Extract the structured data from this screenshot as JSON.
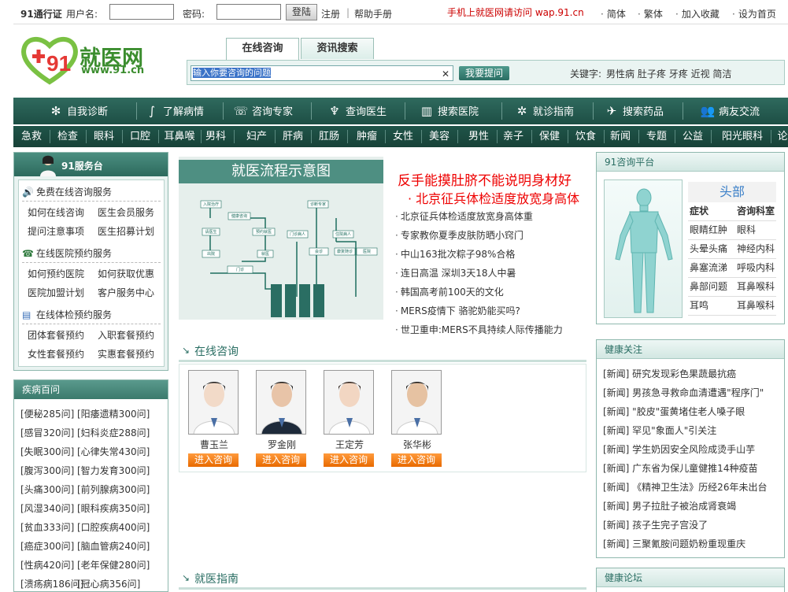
{
  "topbar": {
    "brand": "91通行证",
    "username_label": "用户名:",
    "password_label": "密码:",
    "login_button": "登陆",
    "register": "注册",
    "help": "帮助手册",
    "mobile_notice": "手机上就医网请访问  wap.91.cn",
    "links": [
      "简体",
      "繁体",
      "加入收藏",
      "设为首页"
    ]
  },
  "logo": {
    "name": "就医网",
    "url": "www.91.cn",
    "mark": "91"
  },
  "search": {
    "tabs": [
      "在线咨询",
      "资讯搜索"
    ],
    "input_value": "输入你要咨询的问题",
    "ask_button": "我要提问",
    "keywords_label": "关键字:",
    "keywords": [
      "男性病",
      "肚子疼",
      "牙疼",
      "近视",
      "简洁"
    ]
  },
  "main_nav": [
    {
      "label": "自我诊断",
      "icon": "flower-icon"
    },
    {
      "label": "了解病情",
      "icon": "stethoscope-icon"
    },
    {
      "label": "咨询专家",
      "icon": "phone-user-icon"
    },
    {
      "label": "查询医生",
      "icon": "doctor-icon"
    },
    {
      "label": "搜索医院",
      "icon": "hospital-icon"
    },
    {
      "label": "就诊指南",
      "icon": "compass-icon"
    },
    {
      "label": "搜索药品",
      "icon": "plane-icon"
    },
    {
      "label": "病友交流",
      "icon": "people-icon"
    }
  ],
  "sub_nav": [
    "急救",
    "检查",
    "眼科",
    "口腔",
    "耳鼻喉",
    "男科",
    "妇产",
    "肝病",
    "肛肠",
    "肿瘤",
    "女性",
    "美容",
    "男性",
    "亲子",
    "保健",
    "饮食",
    "新闻",
    "专题",
    "公益",
    "阳光眼科",
    "论"
  ],
  "service": {
    "title": "91服务台",
    "sections": [
      {
        "title": "免费在线咨询服务",
        "icon": "speaker-icon",
        "links": [
          "如何在线咨询",
          "医生会员服务",
          "提问注意事项",
          "医生招募计划"
        ]
      },
      {
        "title": "在线医院预约服务",
        "icon": "telephone-icon",
        "links": [
          "如何预约医院",
          "如何获取优惠",
          "医院加盟计划",
          "客户服务中心"
        ]
      },
      {
        "title": "在线体检预约服务",
        "icon": "clipboard-icon",
        "links": [
          "团体套餐预约",
          "入职套餐预约",
          "女性套餐预约",
          "实惠套餐预约"
        ]
      }
    ]
  },
  "diseases": {
    "title": "疾病百问",
    "rows": [
      [
        "[便秘285问]",
        "[阳痿遗精300问]"
      ],
      [
        "[感冒320问]",
        "[妇科炎症288问]"
      ],
      [
        "[失眠300问]",
        "[心律失常430问]"
      ],
      [
        "[腹泻300问]",
        "[智力发育300问]"
      ],
      [
        "[头痛300问]",
        "[前列腺病300问]"
      ],
      [
        "[风湿340问]",
        "[眼科疾病350问]"
      ],
      [
        "[贫血333问]",
        "[口腔疾病400问]"
      ],
      [
        "[癌症300问]",
        "[脑血管病240问]"
      ],
      [
        "[性病420问]",
        "[老年保健280问]"
      ],
      [
        "[溃疡病186问]",
        "[冠心病356问]"
      ]
    ]
  },
  "flow": {
    "title": "就医流程示意图",
    "nodes": [
      "入院治疗",
      "健康咨询",
      "预约就医",
      "请医生",
      "就医",
      "门诊",
      "出院",
      "诊断专家",
      "门诊病人",
      "住院病人",
      "会诊",
      "康复随诊",
      "医院"
    ]
  },
  "headlines": {
    "main": "反手能摸肚脐不能说明身材好",
    "sub": "· 北京征兵体检适度放宽身高体",
    "items": [
      "北京征兵体检适度放宽身高体重",
      "专家教你夏季皮肤防晒小窍门",
      "中山163批次粽子98%合格",
      "连日高温 深圳3天18人中暑",
      "韩国高考前100天的文化",
      "MERS疫情下 骆驼奶能买吗?",
      "世卫重申:MERS不具持续人际传播能力"
    ]
  },
  "online_consult": {
    "title": "在线咨询",
    "doctors": [
      {
        "name": "曹玉兰",
        "button": "进入咨询"
      },
      {
        "name": "罗金刚",
        "button": "进入咨询"
      },
      {
        "name": "王定芳",
        "button": "进入咨询"
      },
      {
        "name": "张华彬",
        "button": "进入咨询"
      }
    ]
  },
  "guide": {
    "title": "就医指南"
  },
  "platform": {
    "title": "91咨询平台",
    "part": "头部",
    "col_symptom": "症状",
    "col_dept": "咨询科室",
    "rows": [
      [
        "眼睛红肿",
        "眼科"
      ],
      [
        "头晕头痛",
        "神经内科"
      ],
      [
        "鼻塞流涕",
        "呼吸内科"
      ],
      [
        "鼻部问题",
        "耳鼻喉科"
      ],
      [
        "耳鸣",
        "耳鼻喉科"
      ]
    ]
  },
  "health_focus": {
    "title": "健康关注",
    "items": [
      "[新闻] 研究发现彩色果蔬最抗癌",
      "[新闻] 男孩急寻救命血清遭遇\"程序门\"",
      "[新闻] \"胶皮\"蛋黄堵住老人嗓子眼",
      "[新闻] 罕见\"象面人\"引关注",
      "[新闻] 学生奶因安全风险成烫手山芋",
      "[新闻] 广东省为保儿童健推14种疫苗",
      "[新闻] 《精神卫生法》历经26年未出台",
      "[新闻] 男子拉肚子被治成肾衰竭",
      "[新闻] 孩子生完子宫没了",
      "[新闻] 三聚氰胺问题奶粉重现重庆"
    ]
  },
  "forum": {
    "title": "健康论坛"
  },
  "colors": {
    "nav_green": "#1d4e44",
    "accent_teal": "#2a6e63",
    "headline_red": "#e00000",
    "consult_orange": "#f07a10"
  }
}
